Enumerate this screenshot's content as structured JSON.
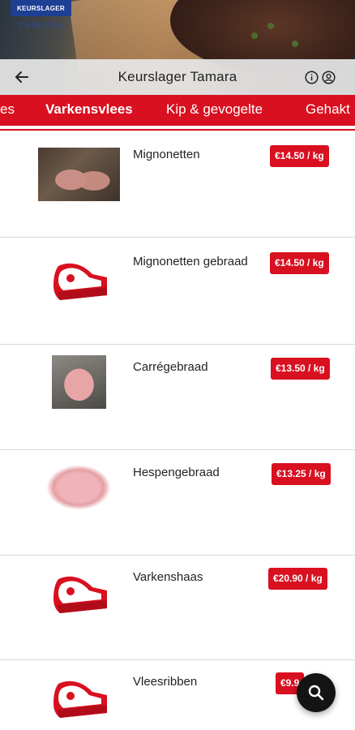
{
  "header": {
    "logo_top": "KEURSLAGER",
    "logo_sub": "TAMARA",
    "title": "Keurslager Tamara"
  },
  "tabs": [
    {
      "label": "es",
      "active": false
    },
    {
      "label": "Varkensvlees",
      "active": true
    },
    {
      "label": "Kip & gevogelte",
      "active": false
    },
    {
      "label": "Gehakt",
      "active": false
    }
  ],
  "products": [
    {
      "name": "Mignonetten",
      "price": "€14.50 / kg",
      "image": "photo"
    },
    {
      "name": "Mignonetten gebraad",
      "price": "€14.50 / kg",
      "image": "meat-icon"
    },
    {
      "name": "Carrégebraad",
      "price": "€13.50 / kg",
      "image": "photo"
    },
    {
      "name": "Hespengebraad",
      "price": "€13.25 / kg",
      "image": "photo"
    },
    {
      "name": "Varkenshaas",
      "price": "€20.90 / kg",
      "image": "meat-icon"
    },
    {
      "name": "Vleesribben",
      "price": "€9.9",
      "image": "meat-icon"
    }
  ],
  "icons": {
    "back": "arrow-left-icon",
    "info": "info-icon",
    "account": "account-circle-icon",
    "search": "search-icon",
    "placeholder": "meat-steak-icon"
  },
  "colors": {
    "brand_red": "#d81020",
    "logo_blue": "#1f3f94"
  }
}
